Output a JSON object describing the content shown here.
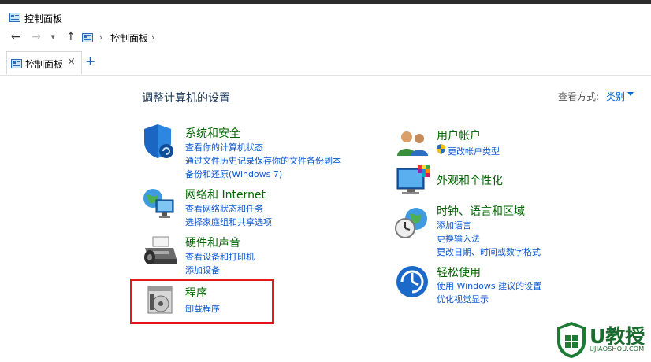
{
  "window": {
    "title": "控制面板"
  },
  "address": {
    "crumb": "控制面板"
  },
  "tabs": [
    {
      "label": "控制面板"
    }
  ],
  "main": {
    "heading": "调整计算机的设置",
    "view_by_label": "查看方式:",
    "view_by_value": "类别"
  },
  "left_categories": [
    {
      "title": "系统和安全",
      "icon": "shield-icon",
      "links": [
        "查看你的计算机状态",
        "通过文件历史记录保存你的文件备份副本",
        "备份和还原(Windows 7)"
      ]
    },
    {
      "title": "网络和 Internet",
      "icon": "network-globe-icon",
      "links": [
        "查看网络状态和任务",
        "选择家庭组和共享选项"
      ]
    },
    {
      "title": "硬件和声音",
      "icon": "printer-speaker-icon",
      "links": [
        "查看设备和打印机",
        "添加设备"
      ]
    },
    {
      "title": "程序",
      "icon": "program-disc-icon",
      "links": [
        "卸载程序"
      ]
    }
  ],
  "right_categories": [
    {
      "title": "用户帐户",
      "icon": "users-icon",
      "links": [
        "更改帐户类型"
      ]
    },
    {
      "title": "外观和个性化",
      "icon": "monitor-colors-icon",
      "links": []
    },
    {
      "title": "时钟、语言和区域",
      "icon": "clock-globe-icon",
      "links": [
        "添加语言",
        "更换输入法",
        "更改日期、时间或数字格式"
      ]
    },
    {
      "title": "轻松使用",
      "icon": "ease-of-access-icon",
      "links": [
        "使用 Windows 建议的设置",
        "优化视觉显示"
      ]
    }
  ],
  "watermark": {
    "brand": "U教授",
    "url": "UJIAOSHOU.COM"
  },
  "colors": {
    "category_title": "#006600",
    "link": "#0b57d0",
    "highlight": "#e5191c"
  }
}
